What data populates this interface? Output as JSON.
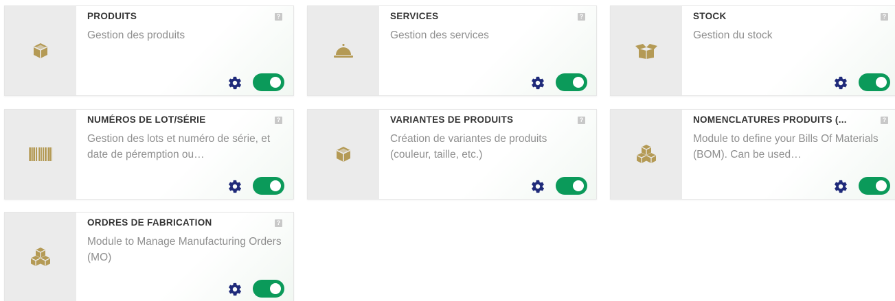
{
  "colors": {
    "icon_gold": "#b49a55",
    "gear_navy": "#1f2a7a",
    "toggle_green": "#0b9a5a",
    "title_text": "#333333",
    "desc_text": "#8f8f8f"
  },
  "modules": [
    {
      "title": "PRODUITS",
      "description": "Gestion des produits",
      "icon": "cube-icon",
      "help": "?",
      "enabled": true
    },
    {
      "title": "SERVICES",
      "description": "Gestion des services",
      "icon": "service-bell-icon",
      "help": "?",
      "enabled": true
    },
    {
      "title": "STOCK",
      "description": "Gestion du stock",
      "icon": "open-box-icon",
      "help": "?",
      "enabled": true
    },
    {
      "title": "NUMÉROS DE LOT/SÉRIE",
      "description": "Gestion des lots et numéro de série, et date de péremption ou…",
      "icon": "barcode-icon",
      "help": "?",
      "enabled": true
    },
    {
      "title": "VARIANTES DE PRODUITS",
      "description": "Création de variantes de produits (couleur, taille, etc.)",
      "icon": "cube-icon",
      "help": "?",
      "enabled": true
    },
    {
      "title": "NOMENCLATURES PRODUITS (...",
      "description": "Module to define your Bills Of Materials (BOM). Can be used…",
      "icon": "cubes-icon",
      "help": "?",
      "enabled": true
    },
    {
      "title": "ORDRES DE FABRICATION",
      "description": "Module to Manage Manufacturing Orders (MO)",
      "icon": "cubes-icon",
      "help": "?",
      "enabled": true
    }
  ]
}
